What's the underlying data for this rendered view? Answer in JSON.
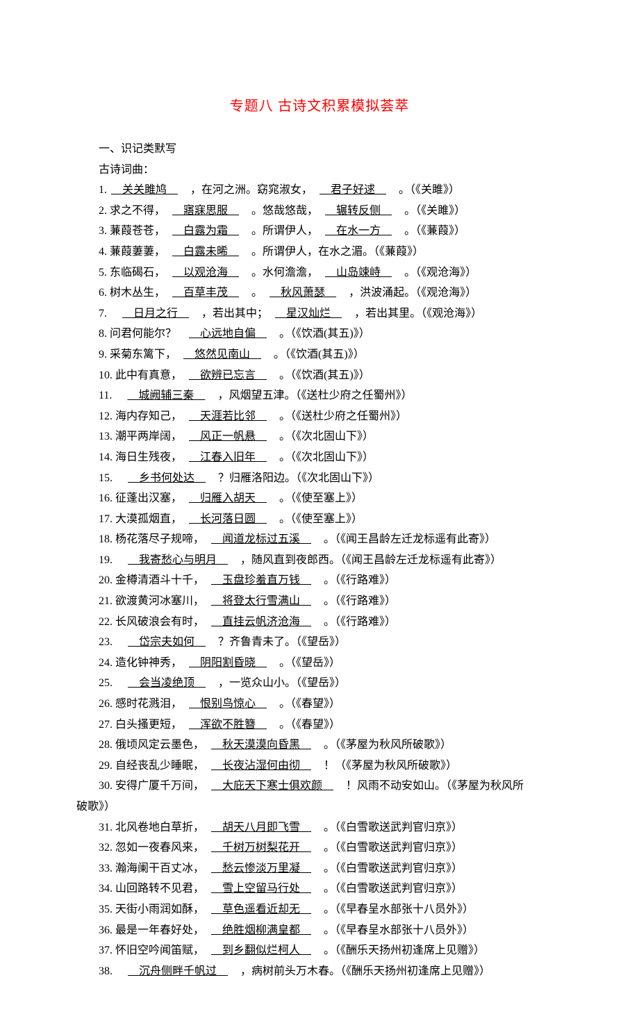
{
  "title": "专题八 古诗文积累模拟荟萃",
  "section1": "一、识记类默写",
  "sub1": "古诗词曲：",
  "items": [
    {
      "n": "1.",
      "parts": [
        "　"
      ],
      "b": "关关雎鸠",
      "parts2": [
        "　，在河之洲。窈窕淑女，　"
      ],
      "b2": "君子好逑",
      "parts3": [
        "　。（《关雎》）"
      ]
    },
    {
      "n": "2.",
      "pre": "求之不得，　",
      "b": "寤寐思服",
      "mid": "　。悠哉悠哉，　",
      "b2": "辗转反侧",
      "post": "　。（《关雎》）"
    },
    {
      "n": "3.",
      "pre": "蒹葭苍苍，　",
      "b": "白露为霜",
      "mid": "　。所谓伊人，　",
      "b2": "在水一方",
      "post": "　。（《蒹葭》）"
    },
    {
      "n": "4.",
      "pre": "蒹葭萋萋，　",
      "b": "白露未晞",
      "post": "　。所谓伊人，在水之湄。（《蒹葭》）"
    },
    {
      "n": "5.",
      "pre": "东临碣石，　",
      "b": "以观沧海",
      "mid": "　。水何澹澹，　",
      "b2": "山岛竦峙",
      "post": "　。（《观沧海》）"
    },
    {
      "n": "6.",
      "pre": "树木丛生，　",
      "b": "百草丰茂",
      "mid": "　。　",
      "b2": "秋风萧瑟",
      "post": "　，洪波涌起。（《观沧海》）"
    },
    {
      "n": "7.",
      "pre": "　",
      "b": "日月之行",
      "mid": "　，若出其中；　",
      "b2": "星汉灿烂",
      "post": "　，若出其里。（《观沧海》）"
    },
    {
      "n": "8.",
      "pre": "问君何能尔？　",
      "b": "心远地自偏",
      "post": "　。（《饮酒(其五)》）"
    },
    {
      "n": "9.",
      "pre": "采菊东篱下，　",
      "b": "悠然见南山",
      "post": "　。（《饮酒(其五)》）"
    },
    {
      "n": "10.",
      "pre": "此中有真意，　",
      "b": "欲辨已忘言",
      "post": "　。（《饮酒(其五)》）"
    },
    {
      "n": "11.",
      "pre": "　",
      "b": "城阙辅三秦",
      "post": "　，风烟望五津。（《送杜少府之任蜀州》）"
    },
    {
      "n": "12.",
      "pre": "海内存知己，　",
      "b": "天涯若比邻",
      "post": "　。（《送杜少府之任蜀州》）"
    },
    {
      "n": "13.",
      "pre": "潮平两岸阔，　",
      "b": "风正一帆悬",
      "post": "　。（《次北固山下》）"
    },
    {
      "n": "14.",
      "pre": "海日生残夜，　",
      "b": "江春入旧年",
      "post": "　。（《次北固山下》）"
    },
    {
      "n": "15.",
      "pre": "　",
      "b": "乡书何处达",
      "post": "　？归雁洛阳边。（《次北固山下》）"
    },
    {
      "n": "16.",
      "pre": "征蓬出汉塞，　",
      "b": "归雁入胡天",
      "post": "　。（《使至塞上》）"
    },
    {
      "n": "17.",
      "pre": "大漠孤烟直，　",
      "b": "长河落日圆",
      "post": "　。（《使至塞上》）"
    },
    {
      "n": "18.",
      "pre": "杨花落尽子规啼，　",
      "b": "闻道龙标过五溪",
      "post": "　。（《闻王昌龄左迁龙标遥有此寄》）"
    },
    {
      "n": "19.",
      "pre": "　",
      "b": "我寄愁心与明月",
      "post": "　，随风直到夜郎西。（《闻王昌龄左迁龙标遥有此寄》）"
    },
    {
      "n": "20.",
      "pre": "金樽清酒斗十千，　",
      "b": "玉盘珍羞直万钱",
      "post": "　。（《行路难》）"
    },
    {
      "n": "21.",
      "pre": "欲渡黄河冰塞川，　",
      "b": "将登太行雪满山",
      "post": "　。（《行路难》）"
    },
    {
      "n": "22.",
      "pre": "长风破浪会有时，　",
      "b": "直挂云帆济沧海",
      "post": "　。（《行路难》）"
    },
    {
      "n": "23.",
      "pre": "　",
      "b": "岱宗夫如何",
      "post": "　？齐鲁青未了。（《望岳》）"
    },
    {
      "n": "24.",
      "pre": "造化钟神秀，　",
      "b": "阴阳割昏晓",
      "post": "　。（《望岳》）"
    },
    {
      "n": "25.",
      "pre": "　",
      "b": "会当凌绝顶",
      "post": "　，一览众山小。（《望岳》）"
    },
    {
      "n": "26.",
      "pre": "感时花溅泪，　",
      "b": "恨别鸟惊心",
      "post": "　。（《春望》）"
    },
    {
      "n": "27.",
      "pre": "白头搔更短，　",
      "b": "浑欲不胜簪",
      "post": "　。（《春望》）"
    },
    {
      "n": "28.",
      "pre": "俄顷风定云墨色，　",
      "b": "秋天漠漠向昏黑",
      "post": "　。（《茅屋为秋风所破歌》）"
    },
    {
      "n": "29.",
      "pre": "自经丧乱少睡眠，　",
      "b": "长夜沾湿何由彻",
      "post": "　！（《茅屋为秋风所破歌》）"
    },
    {
      "n": "30.",
      "pre": "安得广厦千万间，　",
      "b": "大庇天下寒士俱欢颜",
      "post": "　！风雨不动安如山。（《茅屋为秋风所",
      "wrap": "破歌》）"
    },
    {
      "n": "31.",
      "pre": "北风卷地白草折，　",
      "b": "胡天八月即飞雪",
      "post": "　。（《白雪歌送武判官归京》）"
    },
    {
      "n": "32.",
      "pre": "忽如一夜春风来，　",
      "b": "千树万树梨花开",
      "post": "　。（《白雪歌送武判官归京》）"
    },
    {
      "n": "33.",
      "pre": "瀚海阑干百丈冰，　",
      "b": "愁云惨淡万里凝",
      "post": "　。（《白雪歌送武判官归京》）"
    },
    {
      "n": "34.",
      "pre": "山回路转不见君，　",
      "b": "雪上空留马行处",
      "post": "　。（《白雪歌送武判官归京》）"
    },
    {
      "n": "35.",
      "pre": "天街小雨润如酥，　",
      "b": "草色遥看近却无",
      "post": "　。（《早春呈水部张十八员外》）"
    },
    {
      "n": "36.",
      "pre": "最是一年春好处，　",
      "b": "绝胜烟柳满皇都",
      "post": "　。（《早春呈水部张十八员外》）"
    },
    {
      "n": "37.",
      "pre": "怀旧空吟闻笛赋，　",
      "b": "到乡翻似烂柯人",
      "post": "　。（《酬乐天扬州初逢席上见赠》）"
    },
    {
      "n": "38.",
      "pre": "　",
      "b": "沉舟侧畔千帆过",
      "post": "　，病树前头万木春。（《酬乐天扬州初逢席上见赠》）"
    }
  ]
}
